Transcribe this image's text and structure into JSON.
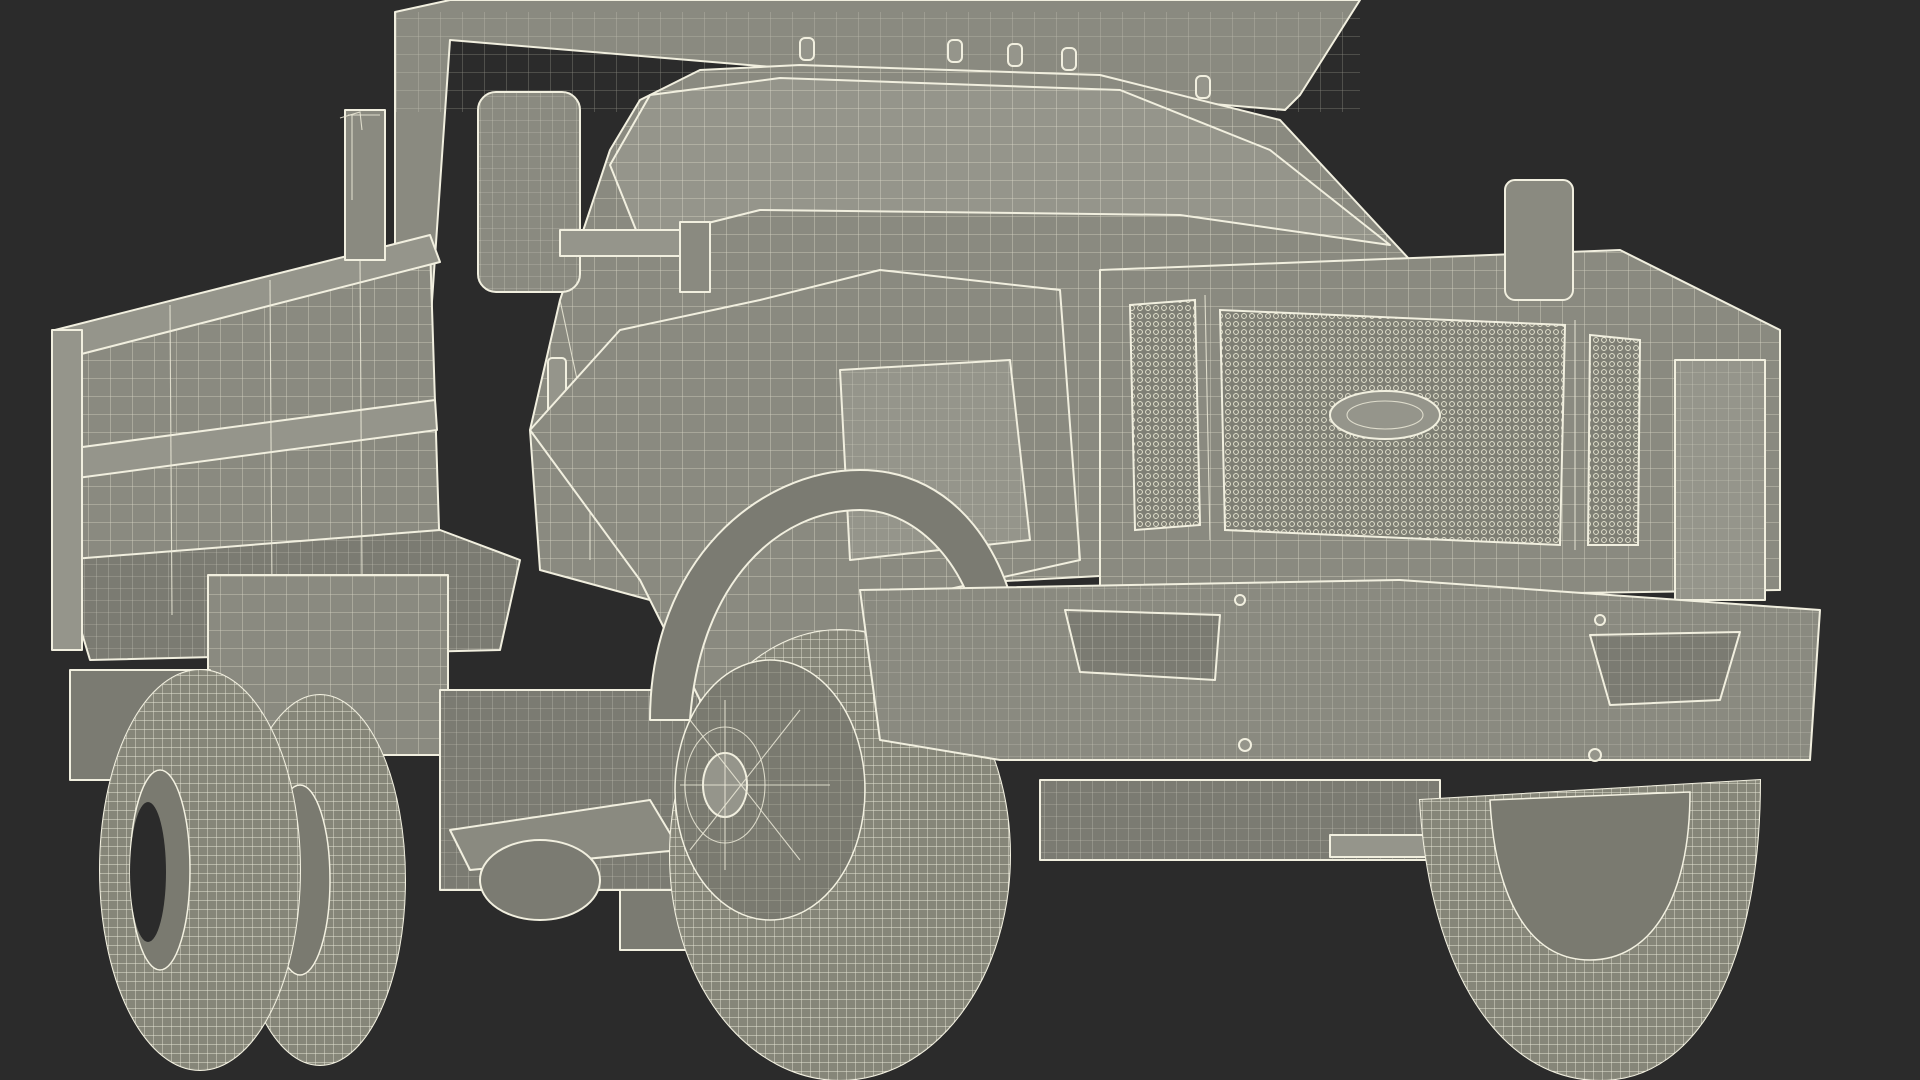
{
  "scene": {
    "subject": "dump-truck-wireframe",
    "background_color": "#2b2b2b",
    "surface_color": "#8a8a80",
    "wire_color": "#f1efdf"
  }
}
